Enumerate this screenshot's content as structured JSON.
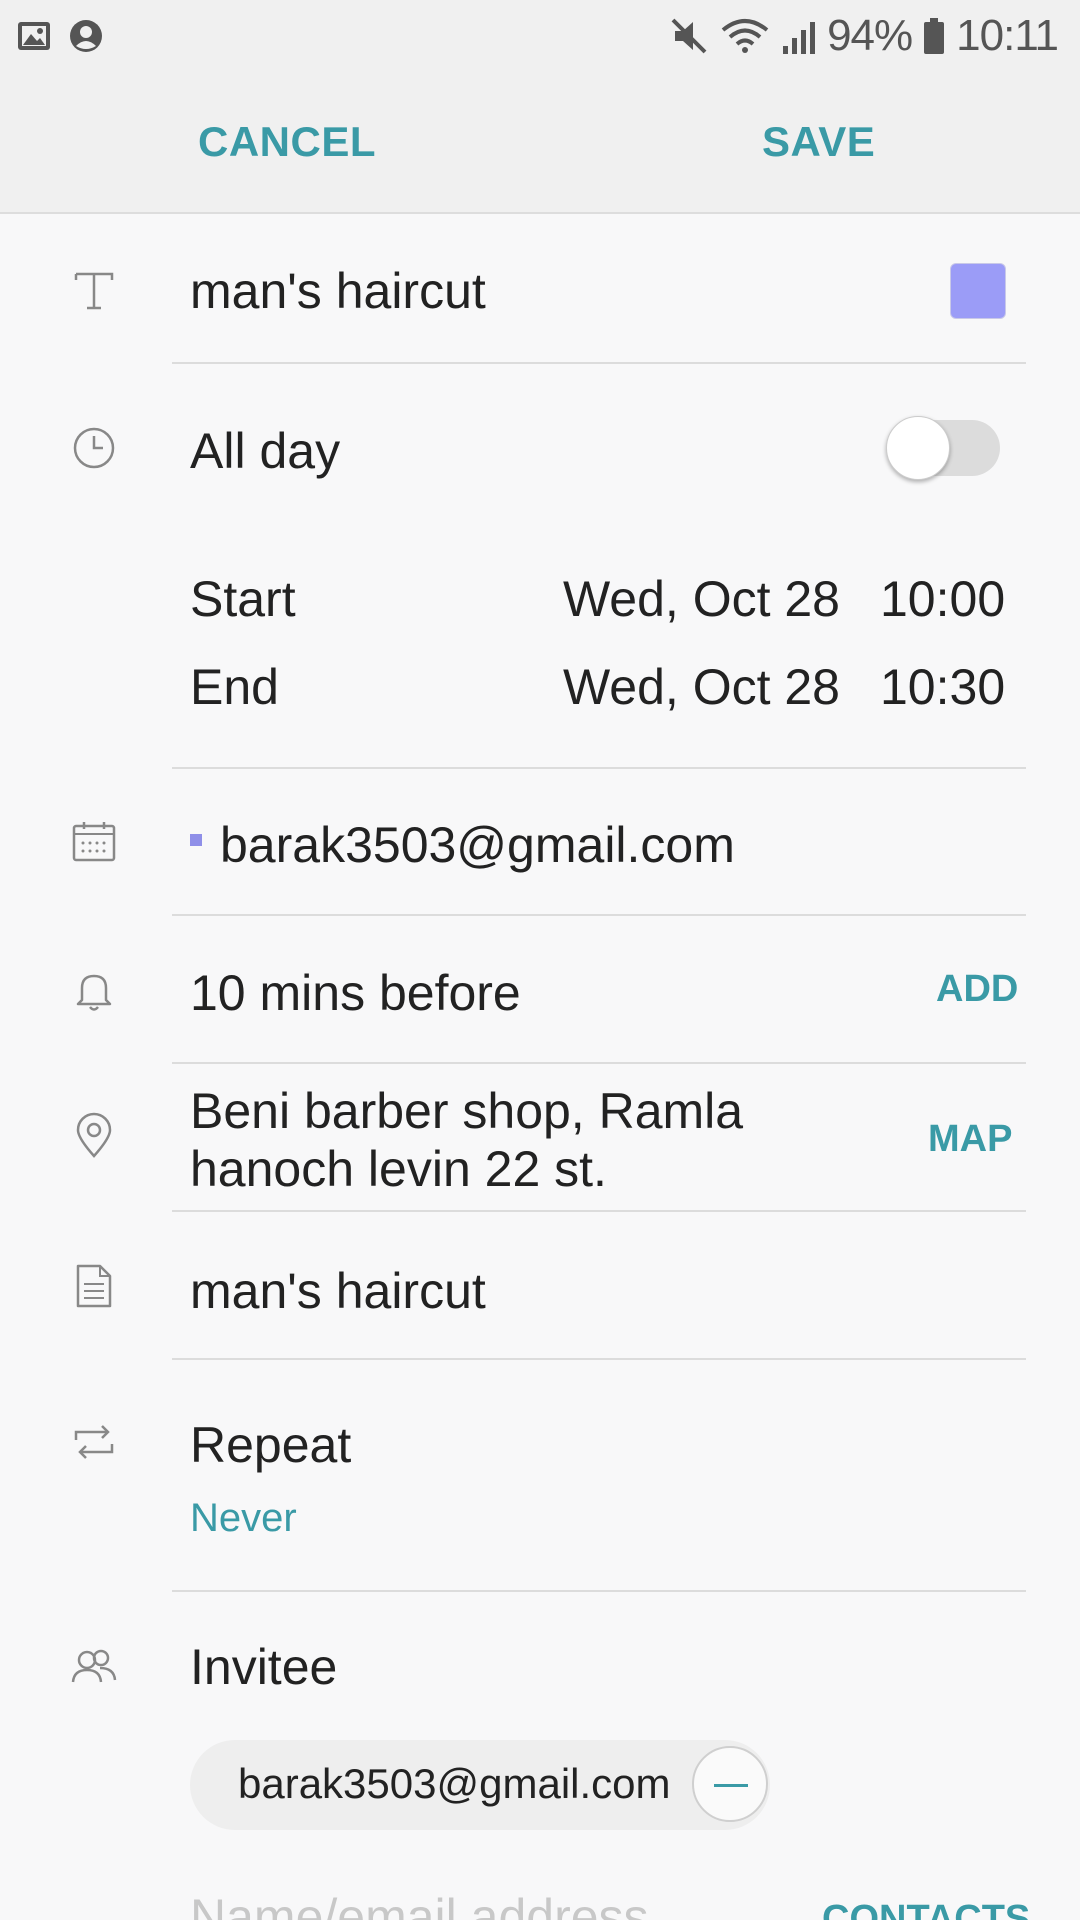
{
  "status_bar": {
    "battery": "94%",
    "time": "10:11",
    "icons": [
      "image-icon",
      "account-icon",
      "mute-icon",
      "wifi-icon",
      "signal-icon",
      "battery-icon"
    ]
  },
  "toolbar": {
    "cancel_label": "CANCEL",
    "save_label": "SAVE"
  },
  "title": {
    "value": "man's haircut",
    "color": "#9b9cf7"
  },
  "all_day": {
    "label": "All day",
    "enabled": false
  },
  "start": {
    "label": "Start",
    "date": "Wed, Oct 28",
    "time": "10:00"
  },
  "end": {
    "label": "End",
    "date": "Wed, Oct 28",
    "time": "10:30"
  },
  "calendar": {
    "account": "barak3503@gmail.com",
    "color": "#8f8fe8"
  },
  "reminder": {
    "value": "10 mins before",
    "action_label": "ADD"
  },
  "location": {
    "line1": "Beni barber shop, Ramla",
    "line2": "hanoch levin 22 st.",
    "action_label": "MAP"
  },
  "notes": {
    "value": "man's haircut"
  },
  "repeat": {
    "label": "Repeat",
    "value": "Never"
  },
  "invitee": {
    "label": "Invitee",
    "chip": "barak3503@gmail.com",
    "input_placeholder": "Name/email address",
    "contacts_label": "CONTACTS"
  },
  "accent_color": "#3a9aa6"
}
